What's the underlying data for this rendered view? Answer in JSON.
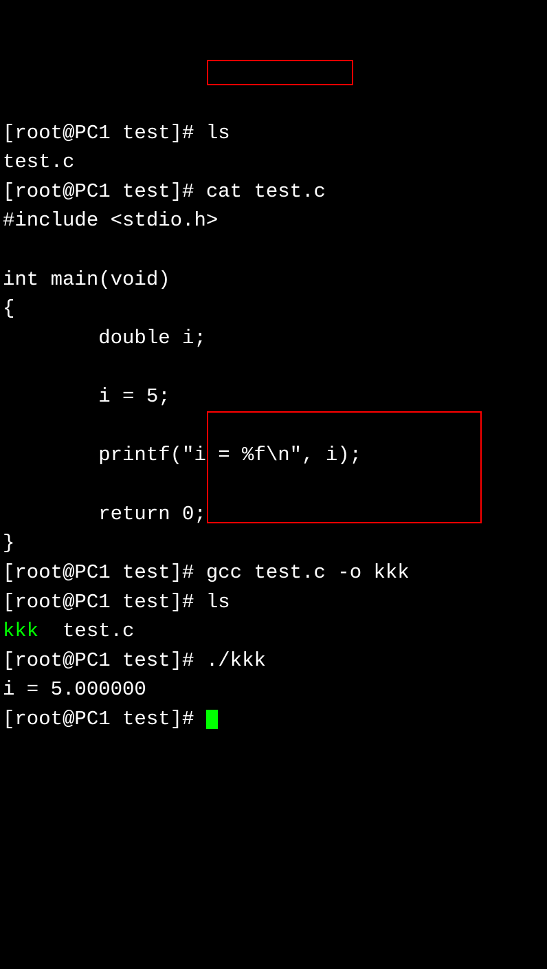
{
  "lines": {
    "l1_prompt": "[root@PC1 test]# ",
    "l1_cmd": "ls",
    "l2": "test.c",
    "l3_prompt": "[root@PC1 test]# ",
    "l3_cmd": "cat test.c",
    "l4": "#include <stdio.h>",
    "l5": "",
    "l6": "int main(void)",
    "l7": "{",
    "l8": "        double i;",
    "l9": "",
    "l10": "        i = 5;",
    "l11": "",
    "l12": "        printf(\"i = %f\\n\", i);",
    "l13": "",
    "l14": "        return 0;",
    "l15": "}",
    "l16_prompt": "[root@PC1 test]# ",
    "l16_cmd": "gcc test.c -o kkk",
    "l17_prompt": "[root@PC1 test]# ",
    "l17_cmd": "ls",
    "l18_kkk": "kkk",
    "l18_rest": "  test.c",
    "l19_prompt": "[root@PC1 test]# ",
    "l19_cmd": "./kkk",
    "l20": "i = 5.000000",
    "l21_prompt": "[root@PC1 test]# "
  }
}
